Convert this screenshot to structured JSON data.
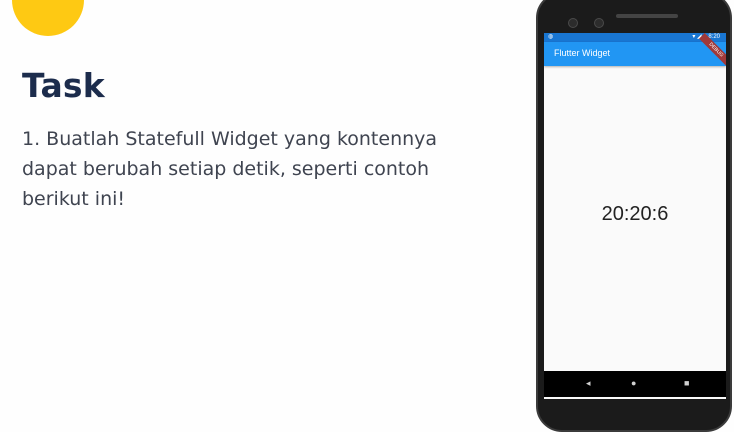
{
  "slide": {
    "title": "Task",
    "instruction": "1. Buatlah Statefull Widget yang kontennya dapat berubah setiap detik, seperti contoh berikut ini!",
    "accent_color": "#fec913",
    "title_color": "#1c2c4c"
  },
  "phone": {
    "status_time": "8:20",
    "app_title": "Flutter Widget",
    "debug_banner": "DEBUG",
    "clock_text": "20:20:6",
    "appbar_color": "#2196f3",
    "nav": {
      "back_icon": "back-triangle-icon",
      "home_icon": "home-circle-icon",
      "recent_icon": "recent-square-icon"
    }
  }
}
